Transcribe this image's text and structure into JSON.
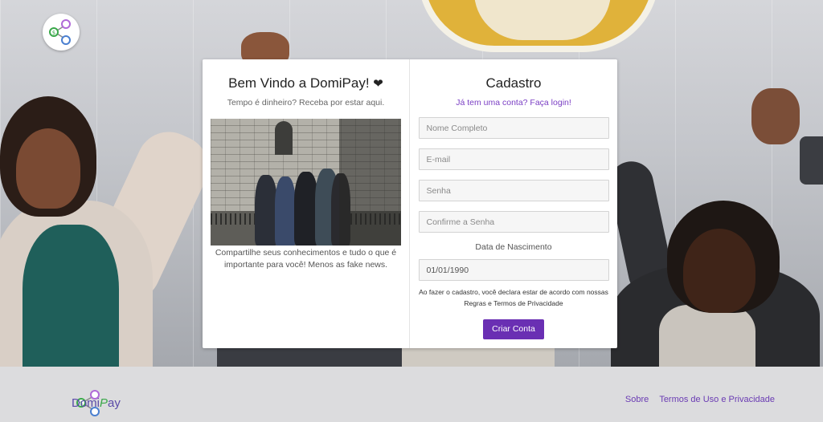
{
  "welcome": {
    "title": "Bem Vindo a DomiPay!",
    "heart": "❤",
    "subtitle": "Tempo é dinheiro? Receba por estar aqui.",
    "caption": "Compartilhe seus conhecimentos e tudo o que é importante para você! Menos as fake news."
  },
  "signup": {
    "title": "Cadastro",
    "login_link": "Já tem uma conta? Faça login!",
    "name_placeholder": "Nome Completo",
    "email_placeholder": "E-mail",
    "password_placeholder": "Senha",
    "confirm_placeholder": "Confirme a Senha",
    "dob_label": "Data de Nascimento",
    "dob_value": "01/01/1990",
    "terms_text": "Ao fazer o cadastro, você declara estar de acordo com nossas Regras e Termos de Privacidade",
    "submit_label": "Criar Conta"
  },
  "footer": {
    "brand_prefix": "Domi",
    "brand_p": "P",
    "brand_suffix": "ay",
    "links": [
      "Sobre",
      "Termos de Uso e Privacidade"
    ]
  },
  "icons": {
    "logo": "domipay-logo-icon"
  },
  "colors": {
    "accent": "#6a2fb3",
    "link": "#7b3fc4",
    "brand_green": "#3aa84a"
  }
}
